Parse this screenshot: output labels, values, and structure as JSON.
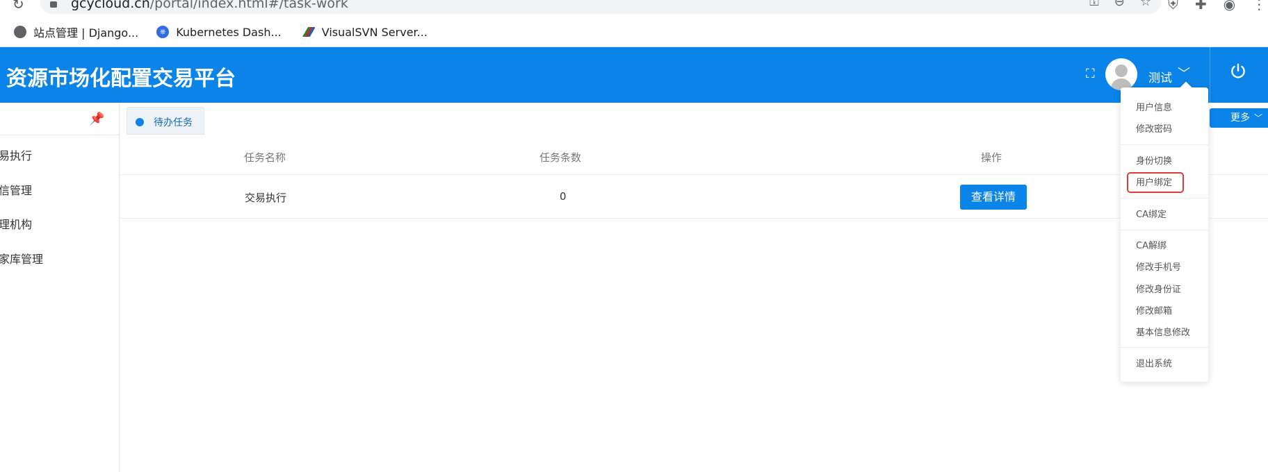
{
  "browser": {
    "url_main": "gcycloud.cn",
    "url_path": "/portal/index.html#/task-work",
    "bookmarks": [
      {
        "label": "站点管理 | Django..."
      },
      {
        "label": "Kubernetes Dash..."
      },
      {
        "label": "VisualSVN Server..."
      }
    ]
  },
  "header": {
    "title": "资源市场化配置交易平台",
    "username": "测试"
  },
  "sidebar": {
    "items": [
      {
        "label": "易执行"
      },
      {
        "label": "信管理"
      },
      {
        "label": "理机构"
      },
      {
        "label": "家库管理"
      }
    ]
  },
  "tabs": [
    {
      "label": "待办任务"
    }
  ],
  "more_button": {
    "label": "更多"
  },
  "table": {
    "headers": [
      "任务名称",
      "任务条数",
      "操作"
    ],
    "rows": [
      {
        "name": "交易执行",
        "count": "0",
        "action": "查看详情"
      }
    ]
  },
  "dropdown": {
    "items": [
      {
        "label": "用户信息"
      },
      {
        "label": "修改密码"
      },
      {
        "label": "身份切换"
      },
      {
        "label": "用户绑定"
      },
      {
        "label": "CA绑定"
      },
      {
        "label": "CA解绑"
      },
      {
        "label": "修改手机号"
      },
      {
        "label": "修改身份证"
      },
      {
        "label": "修改邮箱"
      },
      {
        "label": "基本信息修改"
      },
      {
        "label": "退出系统"
      }
    ]
  },
  "colors": {
    "primary": "#0a84e8",
    "highlight": "#e53935"
  }
}
